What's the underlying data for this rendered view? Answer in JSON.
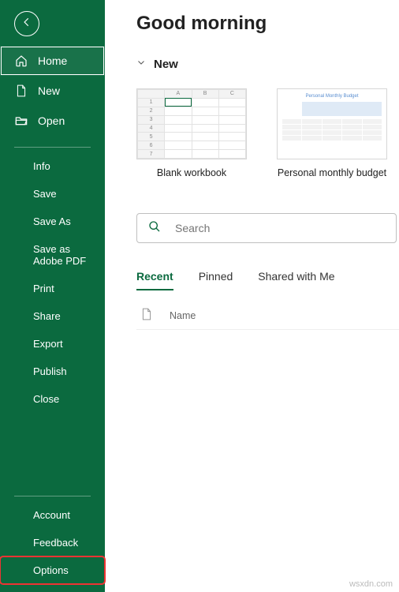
{
  "sidebar": {
    "primary": [
      {
        "label": "Home",
        "icon": "home"
      },
      {
        "label": "New",
        "icon": "page"
      },
      {
        "label": "Open",
        "icon": "folder"
      }
    ],
    "secondary": [
      {
        "label": "Info"
      },
      {
        "label": "Save"
      },
      {
        "label": "Save As"
      },
      {
        "label": "Save as Adobe PDF"
      },
      {
        "label": "Print"
      },
      {
        "label": "Share"
      },
      {
        "label": "Export"
      },
      {
        "label": "Publish"
      },
      {
        "label": "Close"
      }
    ],
    "bottom": [
      {
        "label": "Account"
      },
      {
        "label": "Feedback"
      },
      {
        "label": "Options"
      }
    ]
  },
  "main": {
    "greeting": "Good morning",
    "new_section": "New",
    "templates": [
      {
        "label": "Blank workbook"
      },
      {
        "label": "Personal monthly budget"
      }
    ],
    "search_placeholder": "Search",
    "tabs": [
      {
        "label": "Recent",
        "active": true
      },
      {
        "label": "Pinned",
        "active": false
      },
      {
        "label": "Shared with Me",
        "active": false
      }
    ],
    "columns": {
      "name": "Name"
    }
  },
  "watermark": "wsxdn.com"
}
